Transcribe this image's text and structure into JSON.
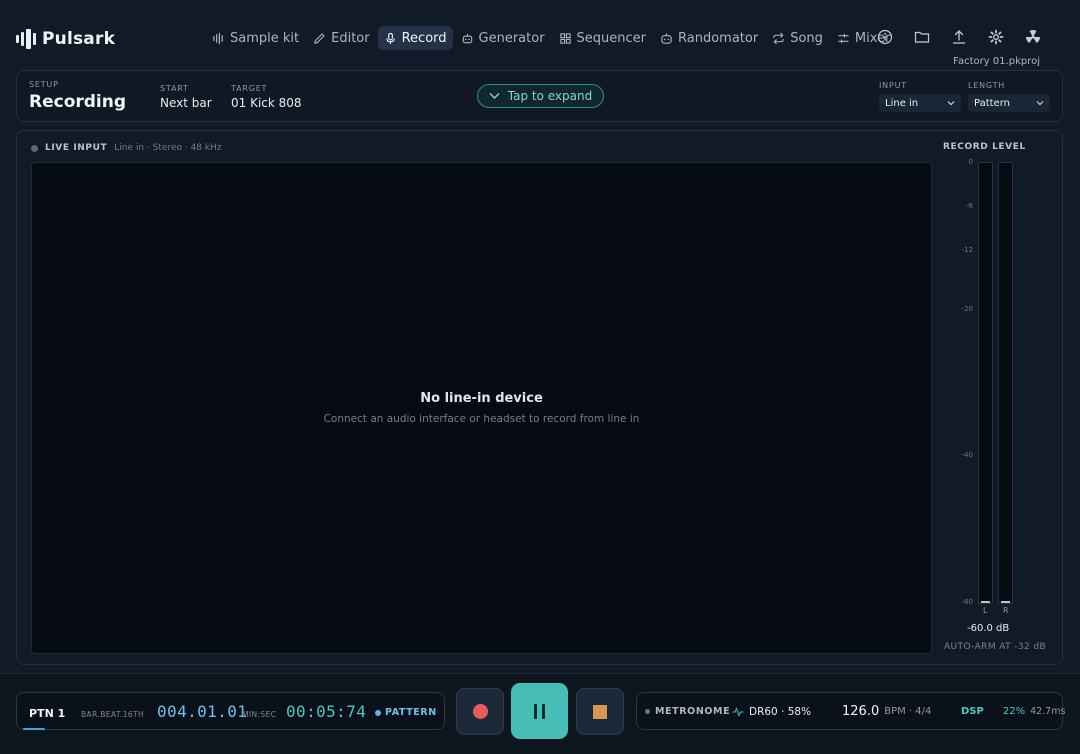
{
  "app": {
    "name": "Pulsark",
    "project": "Factory 01.pkproj"
  },
  "nav": [
    {
      "label": "Sample kit",
      "icon": "waveform-icon",
      "active": false
    },
    {
      "label": "Editor",
      "icon": "pencil-icon",
      "active": false
    },
    {
      "label": "Record",
      "icon": "microphone-icon",
      "active": true
    },
    {
      "label": "Generator",
      "icon": "robot-icon",
      "active": false
    },
    {
      "label": "Sequencer",
      "icon": "grid-icon",
      "active": false
    },
    {
      "label": "Randomator",
      "icon": "dice-icon",
      "active": false
    },
    {
      "label": "Song",
      "icon": "repeat-icon",
      "active": false
    },
    {
      "label": "Mixer",
      "icon": "sliders-icon",
      "active": false
    }
  ],
  "toolbar_icons": [
    "info-icon",
    "folder-icon",
    "upload-icon",
    "gear-icon",
    "radiation-icon"
  ],
  "setup": {
    "section_label": "SETUP",
    "title": "Recording",
    "start_label": "START",
    "start_value": "Next bar",
    "target_label": "TARGET",
    "target_value": "01 Kick 808",
    "expand_label": "Tap to expand",
    "input_label": "INPUT",
    "input_value": "Line in",
    "length_label": "LENGTH",
    "length_value": "Pattern"
  },
  "live": {
    "title": "LIVE INPUT",
    "subtitle": "Line in · Stereo · 48 kHz",
    "empty_title": "No line-in device",
    "empty_sub": "Connect an audio interface or headset to record from line in"
  },
  "meter": {
    "title": "RECORD LEVEL",
    "ticks": [
      "0",
      "-6",
      "-12",
      "-20",
      "-40",
      "-60"
    ],
    "left_label": "L",
    "right_label": "R",
    "left_level": 0,
    "right_level": 0,
    "readout": "-60.0 dB",
    "auto_arm": "AUTO-ARM AT -32 dB"
  },
  "transport": {
    "pattern": "PTN 1",
    "pos_caption": "BAR.BEAT.16TH",
    "pos_value": "004.01.01",
    "time_caption": "MIN:SEC",
    "time_value": "00:05:74",
    "mode": "PATTERN",
    "colors": {
      "record": "#e85a5f",
      "play": "#46bdb6",
      "stop": "#d89a4c"
    }
  },
  "status": {
    "metronome": "METRONOME",
    "kit": "DR60 · 58%",
    "bpm": "126.0",
    "bpm_meta": "BPM · 4/4",
    "dsp_label": "DSP",
    "dsp_value": "22%",
    "latency": "42.7ms"
  }
}
